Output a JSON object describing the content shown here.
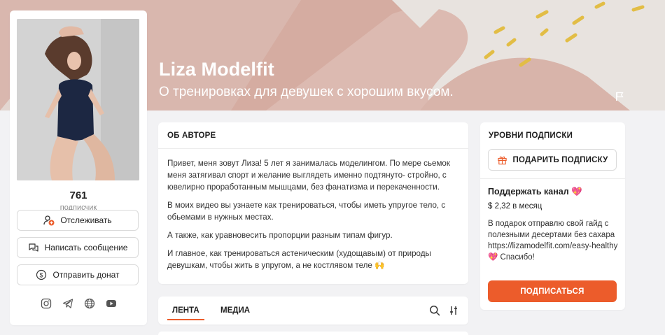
{
  "banner": {
    "title": "Liza Modelfit",
    "subtitle": "О тренировках для девушек с хорошим вкусом.",
    "report_icon": "flag-icon"
  },
  "profile": {
    "subscribers_count": "761",
    "subscribers_label": "подписчик",
    "buttons": {
      "follow": "Отслеживать",
      "message": "Написать сообщение",
      "donate": "Отправить донат"
    },
    "socials": [
      "instagram-icon",
      "telegram-icon",
      "website-icon",
      "youtube-icon"
    ]
  },
  "about": {
    "title": "ОБ АВТОРЕ",
    "paragraphs": [
      "Привет, меня зовут Лиза! 5 лет я занималась моделингом. По мере сьемок меня затягивал спорт и желание выглядеть именно подтянуто- стройно, с ювелирно проработанным мышцами, без фанатизма и перекаченности.",
      "В моих видео вы узнаете как тренироваться, чтобы иметь упругое тело, с обьемами в нужных местах.",
      "А также, как уравновесить пропорции разным типам фигур.",
      "И главное, как тренироваться астеническим (худощавым) от природы девушкам, чтобы жить в упругом, а не костлявом теле 🙌"
    ]
  },
  "feed": {
    "tabs": [
      "ЛЕНТА",
      "МЕДИА"
    ],
    "active_tab": "ЛЕНТА"
  },
  "levels": {
    "title": "УРОВНИ ПОДПИСКИ",
    "gift_label": "ПОДАРИТЬ ПОДПИСКУ",
    "tier": {
      "name": "Поддержать канал 💖",
      "price": "$ 2,32 в месяц",
      "description": "В подарок отправлю свой гайд с полезными десертами без сахара https://lizamodelfit.com/easy-healthy 💖 Спасибо!",
      "subscribe_label": "ПОДПИСАТЬСЯ"
    }
  },
  "colors": {
    "accent": "#ec5c2b",
    "banner_pink": "#d9b5ac",
    "banner_dots": "#e0b83a"
  }
}
